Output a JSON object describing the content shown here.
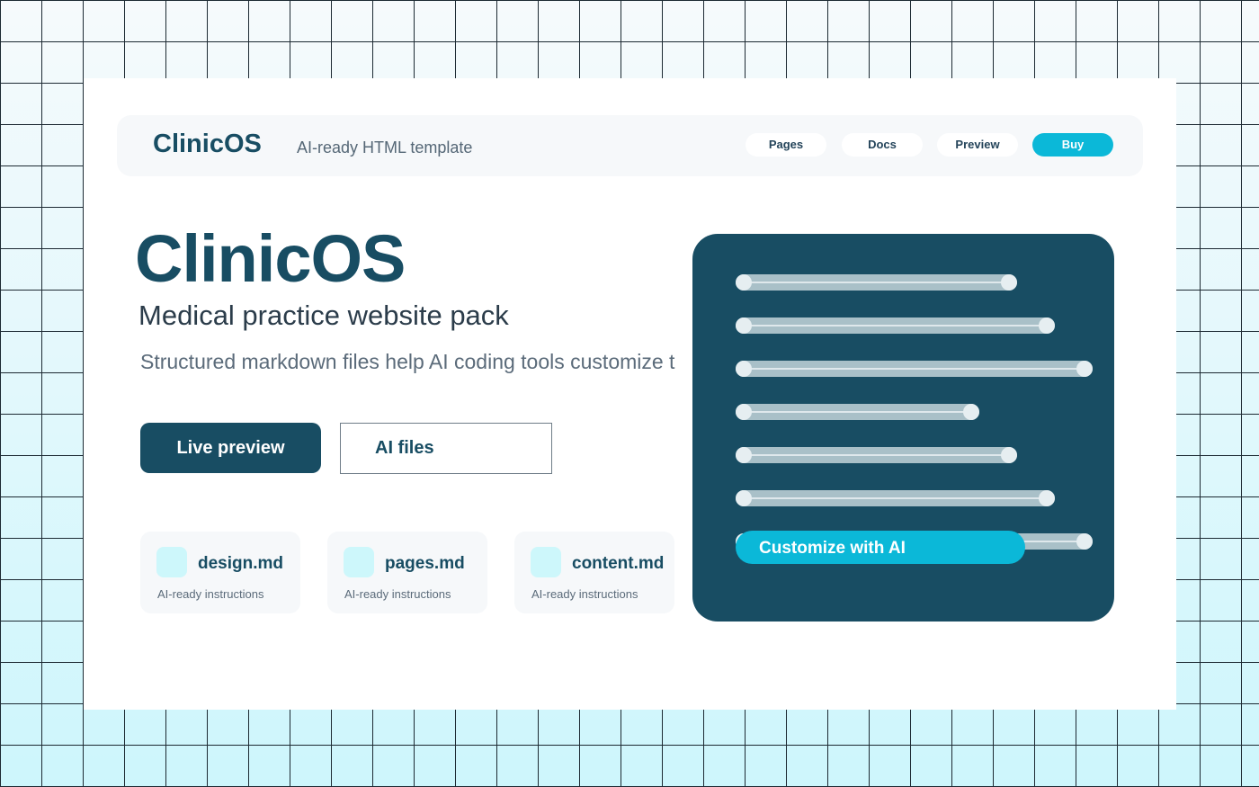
{
  "nav": {
    "brand": "ClinicOS",
    "tagline": "AI-ready HTML template",
    "links": [
      {
        "label": "Pages"
      },
      {
        "label": "Docs"
      },
      {
        "label": "Preview"
      },
      {
        "label": "Buy"
      }
    ]
  },
  "hero": {
    "title": "ClinicOS",
    "subtitle": "Medical practice website pack",
    "description": "Structured markdown files help AI coding tools customize t",
    "primary_button": "Live preview",
    "secondary_button": "AI files"
  },
  "files": [
    {
      "name": "design.md",
      "meta": "AI-ready instructions"
    },
    {
      "name": "pages.md",
      "meta": "AI-ready instructions"
    },
    {
      "name": "content.md",
      "meta": "AI-ready instructions"
    }
  ],
  "panel": {
    "cta_label": "Customize with AI"
  },
  "colors": {
    "brand": "#184d63",
    "accent": "#0bb8d8",
    "surface": "#f6f8fa"
  }
}
